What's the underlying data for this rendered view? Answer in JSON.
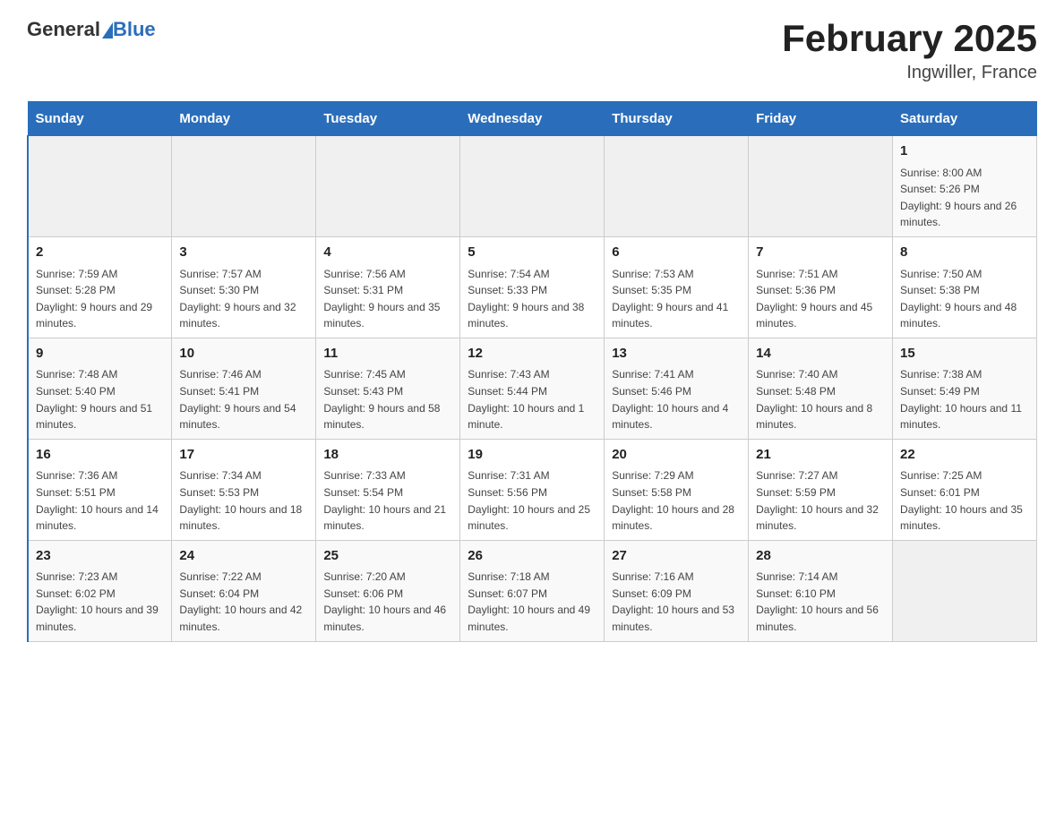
{
  "header": {
    "logo_general": "General",
    "logo_blue": "Blue",
    "month_title": "February 2025",
    "location": "Ingwiller, France"
  },
  "days_of_week": [
    "Sunday",
    "Monday",
    "Tuesday",
    "Wednesday",
    "Thursday",
    "Friday",
    "Saturday"
  ],
  "weeks": [
    [
      {
        "day": "",
        "sunrise": "",
        "sunset": "",
        "daylight": ""
      },
      {
        "day": "",
        "sunrise": "",
        "sunset": "",
        "daylight": ""
      },
      {
        "day": "",
        "sunrise": "",
        "sunset": "",
        "daylight": ""
      },
      {
        "day": "",
        "sunrise": "",
        "sunset": "",
        "daylight": ""
      },
      {
        "day": "",
        "sunrise": "",
        "sunset": "",
        "daylight": ""
      },
      {
        "day": "",
        "sunrise": "",
        "sunset": "",
        "daylight": ""
      },
      {
        "day": "1",
        "sunrise": "Sunrise: 8:00 AM",
        "sunset": "Sunset: 5:26 PM",
        "daylight": "Daylight: 9 hours and 26 minutes."
      }
    ],
    [
      {
        "day": "2",
        "sunrise": "Sunrise: 7:59 AM",
        "sunset": "Sunset: 5:28 PM",
        "daylight": "Daylight: 9 hours and 29 minutes."
      },
      {
        "day": "3",
        "sunrise": "Sunrise: 7:57 AM",
        "sunset": "Sunset: 5:30 PM",
        "daylight": "Daylight: 9 hours and 32 minutes."
      },
      {
        "day": "4",
        "sunrise": "Sunrise: 7:56 AM",
        "sunset": "Sunset: 5:31 PM",
        "daylight": "Daylight: 9 hours and 35 minutes."
      },
      {
        "day": "5",
        "sunrise": "Sunrise: 7:54 AM",
        "sunset": "Sunset: 5:33 PM",
        "daylight": "Daylight: 9 hours and 38 minutes."
      },
      {
        "day": "6",
        "sunrise": "Sunrise: 7:53 AM",
        "sunset": "Sunset: 5:35 PM",
        "daylight": "Daylight: 9 hours and 41 minutes."
      },
      {
        "day": "7",
        "sunrise": "Sunrise: 7:51 AM",
        "sunset": "Sunset: 5:36 PM",
        "daylight": "Daylight: 9 hours and 45 minutes."
      },
      {
        "day": "8",
        "sunrise": "Sunrise: 7:50 AM",
        "sunset": "Sunset: 5:38 PM",
        "daylight": "Daylight: 9 hours and 48 minutes."
      }
    ],
    [
      {
        "day": "9",
        "sunrise": "Sunrise: 7:48 AM",
        "sunset": "Sunset: 5:40 PM",
        "daylight": "Daylight: 9 hours and 51 minutes."
      },
      {
        "day": "10",
        "sunrise": "Sunrise: 7:46 AM",
        "sunset": "Sunset: 5:41 PM",
        "daylight": "Daylight: 9 hours and 54 minutes."
      },
      {
        "day": "11",
        "sunrise": "Sunrise: 7:45 AM",
        "sunset": "Sunset: 5:43 PM",
        "daylight": "Daylight: 9 hours and 58 minutes."
      },
      {
        "day": "12",
        "sunrise": "Sunrise: 7:43 AM",
        "sunset": "Sunset: 5:44 PM",
        "daylight": "Daylight: 10 hours and 1 minute."
      },
      {
        "day": "13",
        "sunrise": "Sunrise: 7:41 AM",
        "sunset": "Sunset: 5:46 PM",
        "daylight": "Daylight: 10 hours and 4 minutes."
      },
      {
        "day": "14",
        "sunrise": "Sunrise: 7:40 AM",
        "sunset": "Sunset: 5:48 PM",
        "daylight": "Daylight: 10 hours and 8 minutes."
      },
      {
        "day": "15",
        "sunrise": "Sunrise: 7:38 AM",
        "sunset": "Sunset: 5:49 PM",
        "daylight": "Daylight: 10 hours and 11 minutes."
      }
    ],
    [
      {
        "day": "16",
        "sunrise": "Sunrise: 7:36 AM",
        "sunset": "Sunset: 5:51 PM",
        "daylight": "Daylight: 10 hours and 14 minutes."
      },
      {
        "day": "17",
        "sunrise": "Sunrise: 7:34 AM",
        "sunset": "Sunset: 5:53 PM",
        "daylight": "Daylight: 10 hours and 18 minutes."
      },
      {
        "day": "18",
        "sunrise": "Sunrise: 7:33 AM",
        "sunset": "Sunset: 5:54 PM",
        "daylight": "Daylight: 10 hours and 21 minutes."
      },
      {
        "day": "19",
        "sunrise": "Sunrise: 7:31 AM",
        "sunset": "Sunset: 5:56 PM",
        "daylight": "Daylight: 10 hours and 25 minutes."
      },
      {
        "day": "20",
        "sunrise": "Sunrise: 7:29 AM",
        "sunset": "Sunset: 5:58 PM",
        "daylight": "Daylight: 10 hours and 28 minutes."
      },
      {
        "day": "21",
        "sunrise": "Sunrise: 7:27 AM",
        "sunset": "Sunset: 5:59 PM",
        "daylight": "Daylight: 10 hours and 32 minutes."
      },
      {
        "day": "22",
        "sunrise": "Sunrise: 7:25 AM",
        "sunset": "Sunset: 6:01 PM",
        "daylight": "Daylight: 10 hours and 35 minutes."
      }
    ],
    [
      {
        "day": "23",
        "sunrise": "Sunrise: 7:23 AM",
        "sunset": "Sunset: 6:02 PM",
        "daylight": "Daylight: 10 hours and 39 minutes."
      },
      {
        "day": "24",
        "sunrise": "Sunrise: 7:22 AM",
        "sunset": "Sunset: 6:04 PM",
        "daylight": "Daylight: 10 hours and 42 minutes."
      },
      {
        "day": "25",
        "sunrise": "Sunrise: 7:20 AM",
        "sunset": "Sunset: 6:06 PM",
        "daylight": "Daylight: 10 hours and 46 minutes."
      },
      {
        "day": "26",
        "sunrise": "Sunrise: 7:18 AM",
        "sunset": "Sunset: 6:07 PM",
        "daylight": "Daylight: 10 hours and 49 minutes."
      },
      {
        "day": "27",
        "sunrise": "Sunrise: 7:16 AM",
        "sunset": "Sunset: 6:09 PM",
        "daylight": "Daylight: 10 hours and 53 minutes."
      },
      {
        "day": "28",
        "sunrise": "Sunrise: 7:14 AM",
        "sunset": "Sunset: 6:10 PM",
        "daylight": "Daylight: 10 hours and 56 minutes."
      },
      {
        "day": "",
        "sunrise": "",
        "sunset": "",
        "daylight": ""
      }
    ]
  ]
}
